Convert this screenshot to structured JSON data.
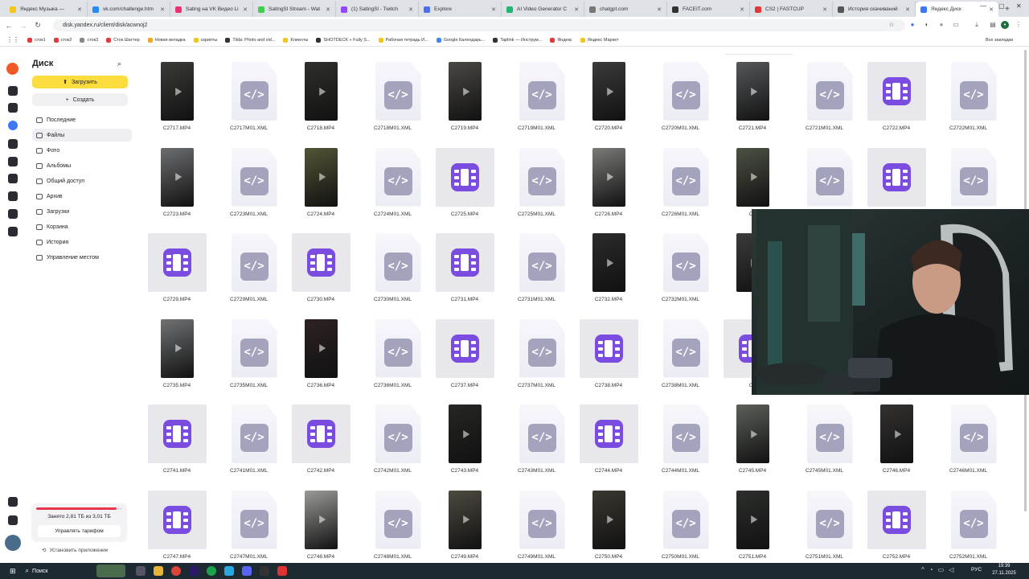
{
  "browser": {
    "tabs": [
      {
        "label": "Яндекс Музыка —",
        "color": "#f5c518",
        "active": false
      },
      {
        "label": "vk.com/challenge.htm",
        "color": "#2787f5",
        "active": false
      },
      {
        "label": "Sating на VK Видео Li",
        "color": "#e8336e",
        "active": false
      },
      {
        "label": "SatingSl Stream - Wat",
        "color": "#3fcf4a",
        "active": false
      },
      {
        "label": "(1) SatingSl - Twitch",
        "color": "#9146ff",
        "active": false
      },
      {
        "label": "Explore",
        "color": "#4b6ef5",
        "active": false
      },
      {
        "label": "AI Video Generator C",
        "color": "#22b573",
        "active": false
      },
      {
        "label": "chatgpt.com",
        "color": "#777777",
        "active": false
      },
      {
        "label": "FACEIT.com",
        "color": "#333333",
        "active": false
      },
      {
        "label": "CS2 | FASTCUP",
        "color": "#e23a3a",
        "active": false
      },
      {
        "label": "История скачиваний",
        "color": "#555555",
        "active": false
      },
      {
        "label": "Яндекс Диск",
        "color": "#3d77f1",
        "active": true
      }
    ],
    "new_tab": "+",
    "url": "disk.yandex.ru/client/disk/acwnoj2",
    "bookmarks": [
      {
        "label": "сток1",
        "color": "#e23a3a"
      },
      {
        "label": "сток2",
        "color": "#e23a3a"
      },
      {
        "label": "сток3",
        "color": "#888888"
      },
      {
        "label": "Сток Шаттер",
        "color": "#e23a3a"
      },
      {
        "label": "Новая вкладка",
        "color": "#f5a623"
      },
      {
        "label": "скрипты",
        "color": "#f5c518"
      },
      {
        "label": "Tilda: Photo and vid...",
        "color": "#333333"
      },
      {
        "label": "Клиенты",
        "color": "#f5c518"
      },
      {
        "label": "SHOTDECK » Fully S...",
        "color": "#333333"
      },
      {
        "label": "Рабочая тетрадь И...",
        "color": "#f5c518"
      },
      {
        "label": "Google Календарь...",
        "color": "#4285f4"
      },
      {
        "label": "Taplink — Инструм...",
        "color": "#333333"
      },
      {
        "label": "Яндекс",
        "color": "#e23a3a"
      },
      {
        "label": "Яндекс Маркет",
        "color": "#f5c518"
      }
    ],
    "all_bookmarks": "Все закладки"
  },
  "sidebar": {
    "title": "Диск",
    "upload": "Загрузить",
    "create": "Создать",
    "items": [
      {
        "label": "Последние",
        "active": false
      },
      {
        "label": "Файлы",
        "active": true
      },
      {
        "label": "Фото",
        "active": false
      },
      {
        "label": "Альбомы",
        "active": false
      },
      {
        "label": "Общий доступ",
        "active": false
      },
      {
        "label": "Архив",
        "active": false
      },
      {
        "label": "Загрузки",
        "active": false
      },
      {
        "label": "Корзина",
        "active": false
      },
      {
        "label": "История",
        "active": false
      },
      {
        "label": "Управление местом",
        "active": false
      }
    ],
    "quota_text": "Занято 2,81 ТБ из 3,01 ТБ",
    "quota_fill": 0.93,
    "manage_plan": "Управлять тарифом",
    "install_app": "Установить приложение"
  },
  "files": {
    "rows": [
      [
        "C2717.MP4",
        "C2717M01.XML",
        "C2718.MP4",
        "C2718M01.XML",
        "C2719.MP4",
        "C2719M01.XML",
        "C2720.MP4",
        "C2720M01.XML",
        "C2721.MP4",
        "C2721M01.XML",
        "C2722.MP4",
        "C2722M01.XML"
      ],
      [
        "C2723.MP4",
        "C2723M01.XML",
        "C2724.MP4",
        "C2724M01.XML",
        "C2725.MP4",
        "C2725M01.XML",
        "C2726.MP4",
        "C2726M01.XML",
        "C2",
        "",
        "",
        ""
      ],
      [
        "C2729.MP4",
        "C2729M01.XML",
        "C2730.MP4",
        "C2730M01.XML",
        "C2731.MP4",
        "C2731M01.XML",
        "C2732.MP4",
        "C2732M01.XML",
        "",
        "",
        "",
        ""
      ],
      [
        "C2735.MP4",
        "C2735M01.XML",
        "C2736.MP4",
        "C2736M01.XML",
        "C2737.MP4",
        "C2737M01.XML",
        "C2738.MP4",
        "C2738M01.XML",
        "C2",
        "",
        "",
        ""
      ],
      [
        "C2741.MP4",
        "C2741M01.XML",
        "C2742.MP4",
        "C2742M01.XML",
        "C2743.MP4",
        "C2743M01.XML",
        "C2744.MP4",
        "C2744M01.XML",
        "C2745.MP4",
        "C2745M01.XML",
        "C2746.MP4",
        "C2746M01.XML"
      ],
      [
        "C2747.MP4",
        "C2747M01.XML",
        "C2748.MP4",
        "C2748M01.XML",
        "C2749.MP4",
        "C2749M01.XML",
        "C2750.MP4",
        "C2750M01.XML",
        "C2751.MP4",
        "C2751M01.XML",
        "C2752.MP4",
        "C2752M01.XML"
      ]
    ],
    "thumb_kinds": [
      [
        "vidA",
        "xml",
        "vidB",
        "xml",
        "vidC",
        "xml",
        "vidD",
        "xml",
        "vidE",
        "xml",
        "player",
        "xml"
      ],
      [
        "vidF",
        "xml",
        "vidG",
        "xml",
        "player",
        "xml",
        "vidH",
        "xml",
        "vidI",
        "xml",
        "player",
        "xml"
      ],
      [
        "player",
        "xml",
        "player",
        "xml",
        "player",
        "xml",
        "vidJ",
        "xml",
        "vidK",
        "",
        "",
        ""
      ],
      [
        "vidL",
        "xml",
        "vidM",
        "xml",
        "player",
        "xml",
        "player",
        "xml",
        "player",
        "",
        "",
        ""
      ],
      [
        "player",
        "xml",
        "player",
        "xml",
        "vidN",
        "xml",
        "player",
        "xml",
        "vidO",
        "xml",
        "vidP",
        "xml"
      ],
      [
        "player",
        "xml",
        "vidQ",
        "xml",
        "vidR",
        "xml",
        "vidS",
        "xml",
        "vidT",
        "xml",
        "player",
        "xml"
      ]
    ]
  },
  "taskbar": {
    "search": "Поиск",
    "lang": "РУС",
    "time": "19:39",
    "date": "27.11.2025"
  }
}
